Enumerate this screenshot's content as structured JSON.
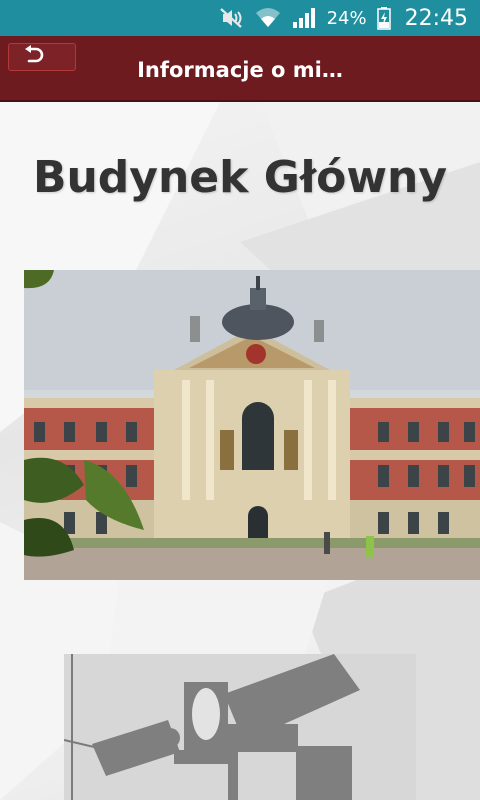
{
  "status_bar": {
    "battery_pct": "24%",
    "time": "22:45",
    "icons": [
      "mute-icon",
      "wifi-icon",
      "signal-icon",
      "battery-icon"
    ],
    "color": "#1f8fa0"
  },
  "header": {
    "title": "Informacje o mi…",
    "back_icon": "undo-arrow-icon",
    "color": "#6e1b1f"
  },
  "main": {
    "building_name": "Budynek Główny",
    "photo": "building-photo",
    "map": "building-map"
  }
}
